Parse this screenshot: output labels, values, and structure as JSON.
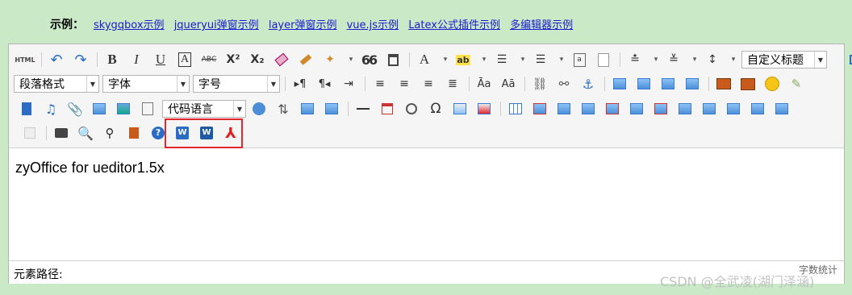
{
  "header": {
    "label": "示例：",
    "links": [
      "skygqbox示例",
      "jqueryui弹窗示例",
      "layer弹窗示例",
      "vue.js示例",
      "Latex公式插件示例",
      "多编辑器示例"
    ]
  },
  "toolbar": {
    "html_label": "HTML",
    "bold": "B",
    "italic": "I",
    "underline": "U",
    "fontborder": "A",
    "strike": "ABC",
    "superscript": "X²",
    "subscript": "X₂",
    "quote": "66",
    "forecolor": "A",
    "title_combo": "自定义标题",
    "paragraph_combo": "段落格式",
    "font_combo": "字体",
    "size_combo": "字号",
    "code_combo": "代码语言",
    "omega": "Ω"
  },
  "content": {
    "text": "zyOffice for ueditor1.5x"
  },
  "status": {
    "path_label": "元素路径:",
    "count_label": "字数统计"
  },
  "watermark": "CSDN @全武凌(湖门泽涵)",
  "colors": {
    "background": "#c9e9c7",
    "link": "#1a1ad0",
    "highlight": "#e3262e"
  }
}
